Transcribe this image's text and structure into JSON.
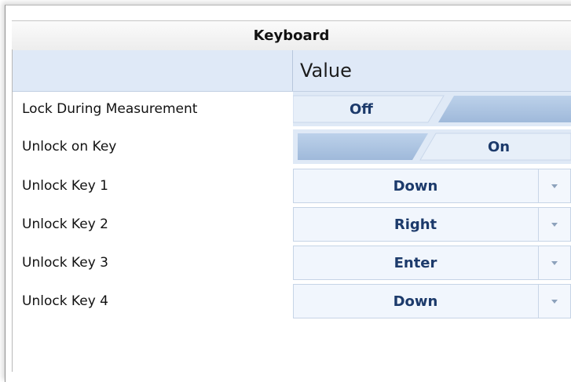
{
  "panel": {
    "title": "Keyboard",
    "value_header": "Value"
  },
  "rows": [
    {
      "label": "Lock During Measurement",
      "type": "toggle",
      "value": "Off"
    },
    {
      "label": "Unlock on Key",
      "type": "toggle",
      "value": "On"
    },
    {
      "label": "Unlock Key 1",
      "type": "dropdown",
      "value": "Down"
    },
    {
      "label": "Unlock Key 2",
      "type": "dropdown",
      "value": "Right"
    },
    {
      "label": "Unlock Key 3",
      "type": "dropdown",
      "value": "Enter"
    },
    {
      "label": "Unlock Key 4",
      "type": "dropdown",
      "value": "Down"
    }
  ],
  "colors": {
    "toggle_active": "#a7c0de",
    "toggle_track": "#dfe9f6",
    "value_text": "#1c3a6b",
    "header_bg": "#dfe9f7"
  },
  "icons": {
    "dropdown": "chevron-down-icon"
  }
}
